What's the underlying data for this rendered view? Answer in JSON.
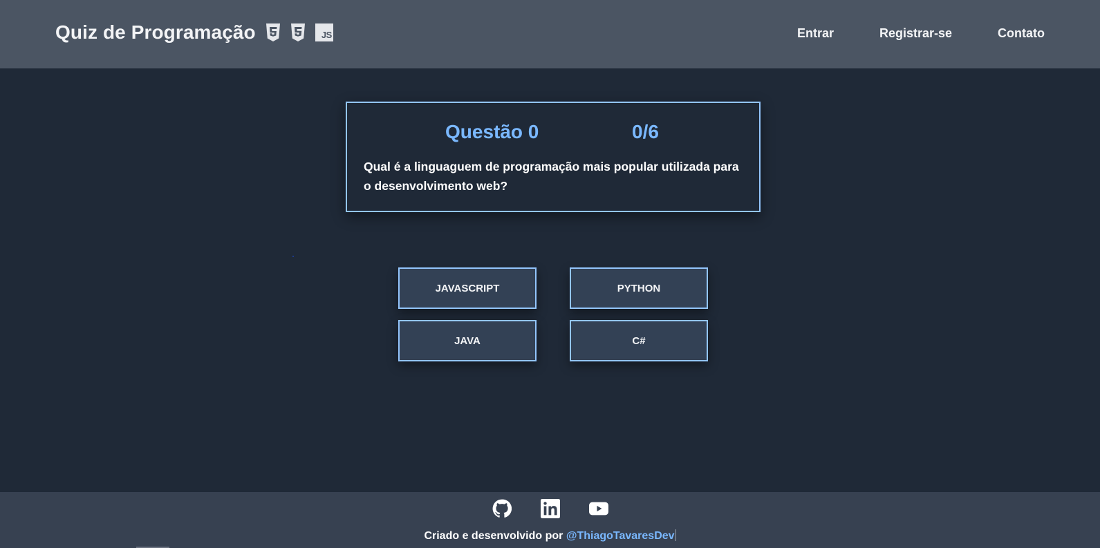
{
  "header": {
    "title": "Quiz de Programação",
    "tech_icons": [
      "html5-icon",
      "css3-icon",
      "javascript-icon"
    ],
    "js_icon_label": "JS",
    "nav": [
      {
        "label": "Entrar"
      },
      {
        "label": "Registrar-se"
      },
      {
        "label": "Contato"
      }
    ]
  },
  "question": {
    "label": "Questão 0",
    "progress": "0/6",
    "text": "Qual é a linguaguem de programação mais popular utilizada para o desenvolvimento web?"
  },
  "answers": [
    {
      "label": "JAVASCRIPT"
    },
    {
      "label": "PYTHON"
    },
    {
      "label": "JAVA"
    },
    {
      "label": "C#"
    }
  ],
  "footer": {
    "socials": [
      "github-icon",
      "linkedin-icon",
      "youtube-icon"
    ],
    "credit_prefix": "Criado e desenvolvido por",
    "credit_handle": "@ThiagoTavaresDev"
  },
  "colors": {
    "header_bg": "#4b5563",
    "page_bg": "#1f2937",
    "footer_bg": "#374151",
    "accent": "#7ab8ff",
    "border": "#93c5fd",
    "button_bg": "#334155"
  }
}
